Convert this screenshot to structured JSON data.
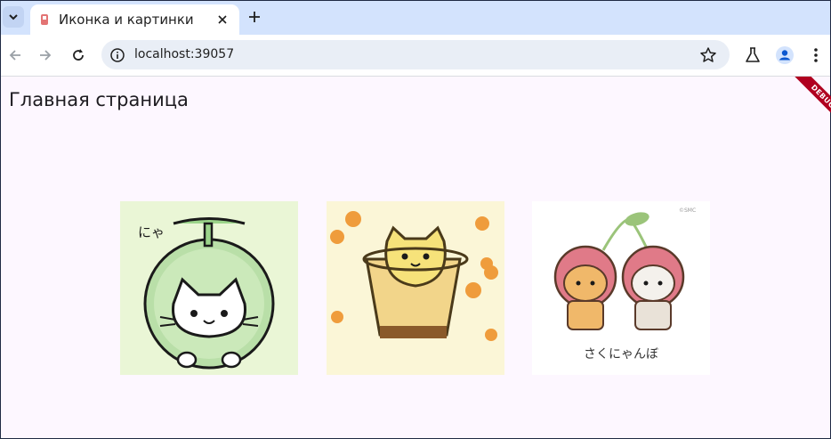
{
  "browser": {
    "tab_title": "Иконка и картинки",
    "url": "localhost:39057"
  },
  "page": {
    "title": "Главная страница",
    "debug_banner": "DEBUG"
  },
  "images": [
    {
      "name": "cat-in-melon",
      "text": "にゃ"
    },
    {
      "name": "cat-in-pudding-cup"
    },
    {
      "name": "cats-as-cherries",
      "caption": "さくにゃんぼ",
      "copyright": "©SMC"
    }
  ],
  "colors": {
    "tabstrip": "#d3e3fd",
    "page_bg": "#fdf7ff",
    "debug": "#b00020"
  }
}
